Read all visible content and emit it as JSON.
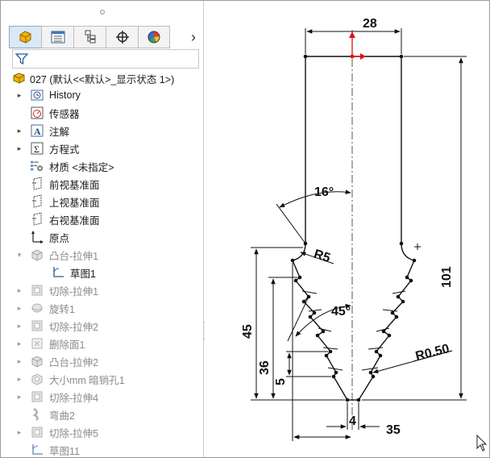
{
  "panel": {
    "tabs": [
      {
        "name": "feature-manager-tab",
        "icon": "feature-manager-icon"
      },
      {
        "name": "property-manager-tab",
        "icon": "property-manager-icon"
      },
      {
        "name": "configuration-manager-tab",
        "icon": "configuration-manager-icon"
      },
      {
        "name": "dimxpert-manager-tab",
        "icon": "dimxpert-icon"
      },
      {
        "name": "display-manager-tab",
        "icon": "display-manager-icon"
      }
    ],
    "next_tab_glyph": "›",
    "filter_icon": "filter-icon",
    "root": {
      "label": "027  (默认<<默认>_显示状态 1>)",
      "icon": "part-icon"
    },
    "items": [
      {
        "label": "History",
        "icon": "history-icon",
        "expand": "▸",
        "dim": false
      },
      {
        "label": "传感器",
        "icon": "sensor-icon",
        "expand": "",
        "dim": false
      },
      {
        "label": "注解",
        "icon": "annotation-icon",
        "expand": "▸",
        "dim": false
      },
      {
        "label": "方程式",
        "icon": "equation-icon",
        "expand": "▸",
        "dim": false
      },
      {
        "label": "材质 <未指定>",
        "icon": "material-icon",
        "expand": "",
        "dim": false
      },
      {
        "label": "前视基准面",
        "icon": "plane-icon",
        "expand": "",
        "dim": false
      },
      {
        "label": "上视基准面",
        "icon": "plane-icon",
        "expand": "",
        "dim": false
      },
      {
        "label": "右视基准面",
        "icon": "plane-icon",
        "expand": "",
        "dim": false
      },
      {
        "label": "原点",
        "icon": "origin-icon",
        "expand": "",
        "dim": false
      },
      {
        "label": "凸台-拉伸1",
        "icon": "boss-extrude-icon",
        "expand": "▾",
        "dim": true
      },
      {
        "label": "草图1",
        "icon": "sketch-icon",
        "expand": "",
        "dim": false,
        "child": true
      },
      {
        "label": "切除-拉伸1",
        "icon": "cut-extrude-icon",
        "expand": "▸",
        "dim": true
      },
      {
        "label": "旋转1",
        "icon": "revolve-icon",
        "expand": "▸",
        "dim": true
      },
      {
        "label": "切除-拉伸2",
        "icon": "cut-extrude-icon",
        "expand": "▸",
        "dim": true
      },
      {
        "label": "删除面1",
        "icon": "delete-face-icon",
        "expand": "▸",
        "dim": true
      },
      {
        "label": "凸台-拉伸2",
        "icon": "boss-extrude-icon",
        "expand": "▸",
        "dim": true
      },
      {
        "label": "大小mm 暗销孔1",
        "icon": "hole-wizard-icon",
        "expand": "▸",
        "dim": true
      },
      {
        "label": "切除-拉伸4",
        "icon": "cut-extrude-icon",
        "expand": "▸",
        "dim": true
      },
      {
        "label": "弯曲2",
        "icon": "flex-icon",
        "expand": "",
        "dim": true
      },
      {
        "label": "切除-拉伸5",
        "icon": "cut-extrude-icon",
        "expand": "▸",
        "dim": true
      },
      {
        "label": "草图11",
        "icon": "sketch-icon",
        "expand": "",
        "dim": true
      }
    ]
  },
  "sketch": {
    "dimensions": {
      "top_width": "28",
      "angle_top": "16°",
      "fillet": "R5",
      "angle_mid": "45°",
      "overall_height": "101",
      "height_45": "45",
      "height_36": "36",
      "step_5": "5",
      "fillet_small": "R0.50",
      "tip_width": "4",
      "half_width": "35"
    },
    "colors": {
      "line": "#111111",
      "origin": "#e0101a",
      "centerline": "#555555"
    }
  }
}
